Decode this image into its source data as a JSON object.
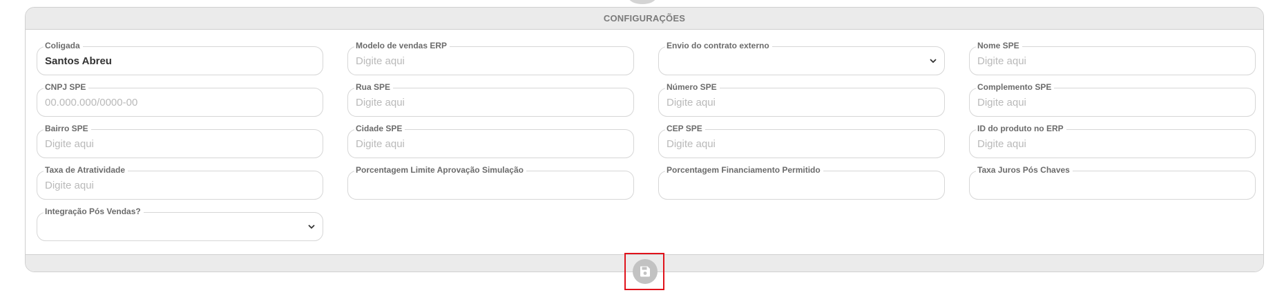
{
  "panel": {
    "title": "CONFIGURAÇÕES"
  },
  "fields": [
    {
      "label": "Coligada",
      "value": "Santos Abreu",
      "placeholder": "",
      "type": "text"
    },
    {
      "label": "Modelo de vendas ERP",
      "value": "",
      "placeholder": "Digite aqui",
      "type": "text"
    },
    {
      "label": "Envio do contrato externo",
      "value": "",
      "placeholder": "",
      "type": "select"
    },
    {
      "label": "Nome SPE",
      "value": "",
      "placeholder": "Digite aqui",
      "type": "text"
    },
    {
      "label": "CNPJ SPE",
      "value": "",
      "placeholder": "00.000.000/0000-00",
      "type": "text"
    },
    {
      "label": "Rua SPE",
      "value": "",
      "placeholder": "Digite aqui",
      "type": "text"
    },
    {
      "label": "Número SPE",
      "value": "",
      "placeholder": "Digite aqui",
      "type": "text"
    },
    {
      "label": "Complemento SPE",
      "value": "",
      "placeholder": "Digite aqui",
      "type": "text"
    },
    {
      "label": "Bairro SPE",
      "value": "",
      "placeholder": "Digite aqui",
      "type": "text"
    },
    {
      "label": "Cidade SPE",
      "value": "",
      "placeholder": "Digite aqui",
      "type": "text"
    },
    {
      "label": "CEP SPE",
      "value": "",
      "placeholder": "Digite aqui",
      "type": "text"
    },
    {
      "label": "ID do produto no ERP",
      "value": "",
      "placeholder": "Digite aqui",
      "type": "text"
    },
    {
      "label": "Taxa de Atratividade",
      "value": "",
      "placeholder": "Digite aqui",
      "type": "text"
    },
    {
      "label": "Porcentagem Limite Aprovação Simulação",
      "value": "",
      "placeholder": "",
      "type": "text"
    },
    {
      "label": "Porcentagem Financiamento Permitido",
      "value": "",
      "placeholder": "",
      "type": "text"
    },
    {
      "label": "Taxa Juros Pós Chaves",
      "value": "",
      "placeholder": "",
      "type": "text"
    },
    {
      "label": "Integração Pós Vendas?",
      "value": "",
      "placeholder": "",
      "type": "select"
    }
  ],
  "save_button": {
    "icon": "floppy-disk-icon",
    "highlight_color": "#e0121b"
  },
  "colors": {
    "header_bg": "#ebebeb",
    "border": "#cfcfcf",
    "label": "#6b6b6b",
    "placeholder": "#b9b9b9",
    "value": "#333333"
  }
}
